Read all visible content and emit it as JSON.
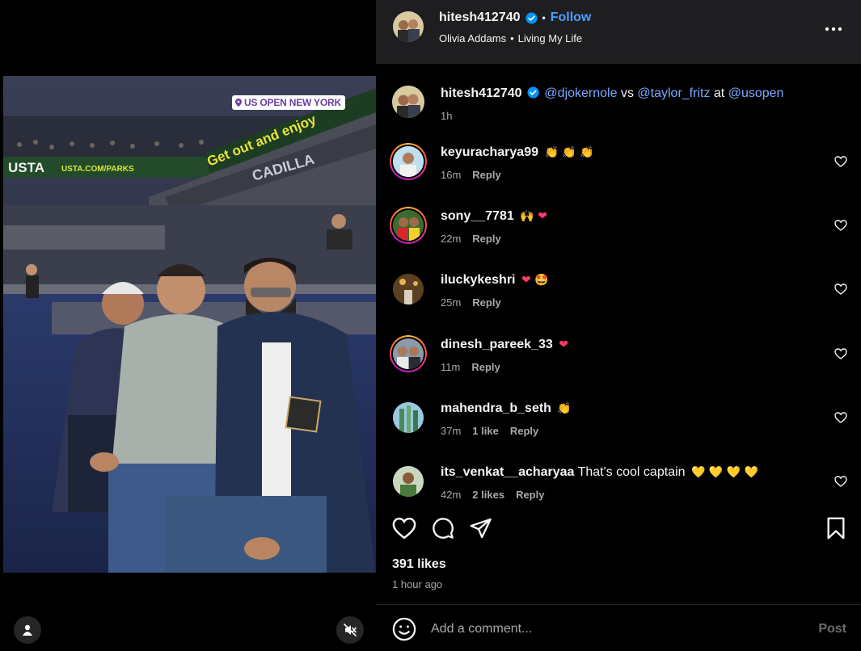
{
  "post": {
    "username": "hitesh412740",
    "follow_label": "Follow",
    "separator": "•",
    "audio_artist": "Olivia Addams",
    "audio_track": "Living My Life",
    "more_icon": "more-horizontal-icon",
    "location_sticker": "US OPEN NEW YORK"
  },
  "caption": {
    "username": "hitesh412740",
    "mention1": "@djokernole",
    "word_vs": "vs",
    "mention2": "@taylor_fritz",
    "word_at": "at",
    "mention3": "@usopen",
    "time": "1h"
  },
  "comments": [
    {
      "username": "keyuracharya99",
      "text": "",
      "emoji": "👏 👏 👏",
      "time": "16m",
      "likes": "",
      "reply": "Reply"
    },
    {
      "username": "sony__7781",
      "text": "",
      "emoji": "🙌 ❤",
      "time": "22m",
      "likes": "",
      "reply": "Reply"
    },
    {
      "username": "iluckykeshri",
      "text": "",
      "emoji": "❤ 🤩",
      "time": "25m",
      "likes": "",
      "reply": "Reply"
    },
    {
      "username": "dinesh_pareek_33",
      "text": "",
      "emoji": "❤",
      "time": "11m",
      "likes": "",
      "reply": "Reply"
    },
    {
      "username": "mahendra_b_seth",
      "text": "",
      "emoji": "👏",
      "time": "37m",
      "likes": "1 like",
      "reply": "Reply"
    },
    {
      "username": "its_venkat__acharyaa",
      "text": "That's cool captain",
      "emoji": "💛 💛 💛 💛",
      "time": "42m",
      "likes": "2 likes",
      "reply": "Reply"
    }
  ],
  "footer": {
    "likes_count": "391 likes",
    "posted_time": "1 hour ago",
    "comment_placeholder": "Add a comment...",
    "post_label": "Post"
  },
  "colors": {
    "accent_blue": "#4a9fff",
    "mention_blue": "#7aa7ff",
    "header_bg": "#1e1e20",
    "muted_text": "#a8a8a8"
  }
}
